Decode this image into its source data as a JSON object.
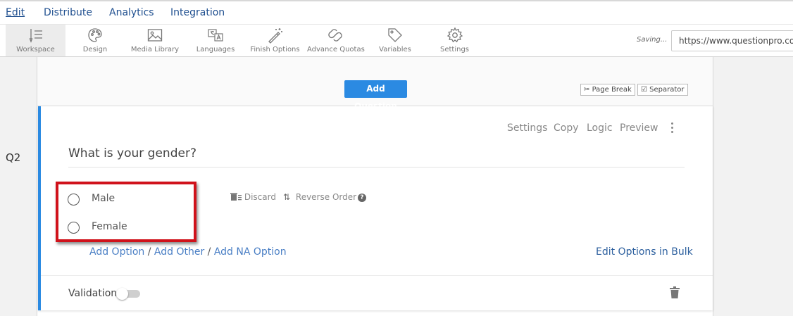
{
  "top_menu": {
    "items": [
      {
        "label": "Edit",
        "active": true
      },
      {
        "label": "Distribute"
      },
      {
        "label": "Analytics"
      },
      {
        "label": "Integration"
      }
    ]
  },
  "toolbar": {
    "items": [
      {
        "label": "Workspace",
        "icon": "workspace-icon",
        "active": true
      },
      {
        "label": "Design",
        "icon": "palette-icon"
      },
      {
        "label": "Media Library",
        "icon": "image-icon"
      },
      {
        "label": "Languages",
        "icon": "translate-icon"
      },
      {
        "label": "Finish Options",
        "icon": "magic-wand-icon"
      },
      {
        "label": "Advance Quotas",
        "icon": "link-icon"
      },
      {
        "label": "Variables",
        "icon": "tag-icon"
      },
      {
        "label": "Settings",
        "icon": "gear-icon"
      }
    ],
    "saving": "Saving...",
    "url": "https://www.questionpro.com"
  },
  "page": {
    "add_question": "Add Question",
    "page_break": "Page Break",
    "separator": "Separator"
  },
  "question": {
    "number": "Q2",
    "actions": [
      "Settings",
      "Copy",
      "Logic",
      "Preview"
    ],
    "text": "What is your gender?",
    "options": [
      "Male",
      "Female"
    ],
    "discard": "Discard",
    "reverse_order": "Reverse Order",
    "help": "?",
    "add_option": "Add Option",
    "add_other": "Add Other",
    "add_na": "Add NA Option",
    "link_separator": "/",
    "edit_bulk": "Edit Options in Bulk",
    "validation_label": "Validation",
    "validation_enabled": false
  },
  "colors": {
    "accent": "#2b8ae2",
    "highlight": "#d0121b",
    "link": "#4a7fc5"
  }
}
